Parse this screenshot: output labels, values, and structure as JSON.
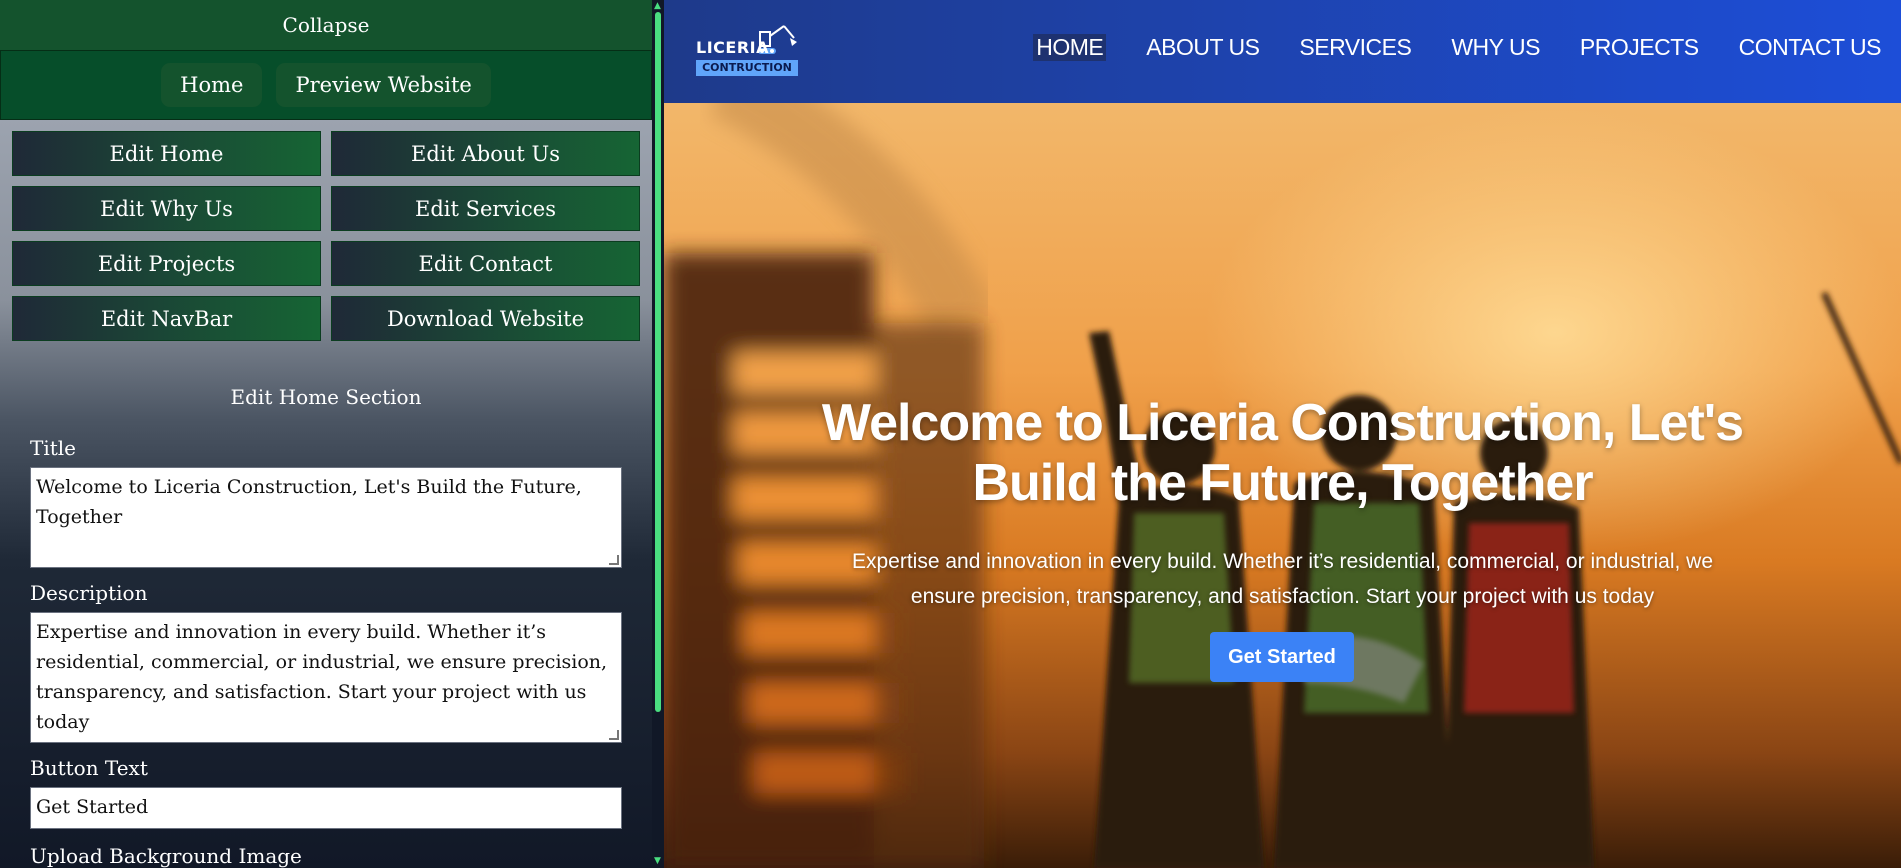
{
  "editor": {
    "collapse_label": "Collapse",
    "top_nav": {
      "home": "Home",
      "preview": "Preview Website"
    },
    "edit_buttons": [
      "Edit Home",
      "Edit About Us",
      "Edit Why Us",
      "Edit Services",
      "Edit Projects",
      "Edit Contact",
      "Edit NavBar",
      "Download Website"
    ],
    "section_heading": "Edit Home Section",
    "fields": {
      "title_label": "Title",
      "title_value": "Welcome to Liceria Construction, Let's Build the Future, Together",
      "description_label": "Description",
      "description_value": "Expertise and innovation in every build. Whether it’s residential, commercial, or industrial, we ensure precision, transparency, and satisfaction. Start your project with us today",
      "button_text_label": "Button Text",
      "button_text_value": "Get Started",
      "upload_label": "Upload Background Image"
    }
  },
  "site": {
    "logo": {
      "word": "LICERIA",
      "sub": "CONTRUCTION"
    },
    "nav": [
      "HOME",
      "ABOUT US",
      "SERVICES",
      "WHY US",
      "PROJECTS",
      "CONTACT US"
    ],
    "active_nav": "HOME",
    "hero": {
      "title": "Welcome to Liceria Construction, Let's Build the Future, Together",
      "description": "Expertise and innovation in every build. Whether it’s residential, commercial, or industrial, we ensure precision, transparency, and satisfaction. Start your project with us today",
      "button": "Get Started"
    }
  },
  "colors": {
    "editor_green": "#14532d",
    "site_nav_blue": "#1e3a8a",
    "hero_button": "#3b82f6",
    "scroll_thumb": "#4ade80"
  }
}
